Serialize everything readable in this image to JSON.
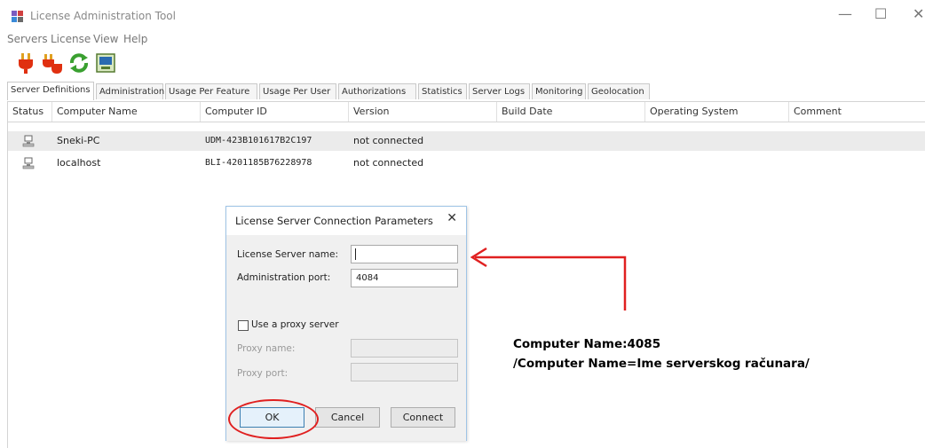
{
  "window": {
    "title": "License Administration Tool",
    "controls": {
      "minimize": "—",
      "maximize": "☐",
      "close": "✕"
    }
  },
  "menu": [
    "Servers",
    "License",
    "View",
    "Help"
  ],
  "toolbar": {
    "buttons": [
      {
        "icon": "connect-plug-icon"
      },
      {
        "icon": "disconnect-plug-icon"
      },
      {
        "icon": "refresh-icon"
      },
      {
        "icon": "server-properties-icon"
      }
    ]
  },
  "tabs": [
    {
      "label": "Server Definitions",
      "active": true
    },
    {
      "label": "Administration"
    },
    {
      "label": "Usage Per Feature"
    },
    {
      "label": "Usage Per User"
    },
    {
      "label": "Authorizations"
    },
    {
      "label": "Statistics"
    },
    {
      "label": "Server Logs"
    },
    {
      "label": "Monitoring"
    },
    {
      "label": "Geolocation"
    }
  ],
  "table": {
    "columns": [
      "Status",
      "Computer Name",
      "Computer ID",
      "Version",
      "Build Date",
      "Operating System",
      "Comment"
    ],
    "rows": [
      {
        "status_icon": "computer-icon",
        "computer_name": "Sneki-PC",
        "computer_id": "UDM-423B101617B2C197",
        "version": "not connected",
        "build_date": "",
        "os": "",
        "comment": ""
      },
      {
        "status_icon": "computer-icon",
        "computer_name": "localhost",
        "computer_id": "BLI-4201185B76228978",
        "version": "not connected",
        "build_date": "",
        "os": "",
        "comment": ""
      }
    ]
  },
  "dialog": {
    "title": "License Server Connection Parameters",
    "close": "✕",
    "server_name_label": "License Server name:",
    "server_name_value": "",
    "admin_port_label": "Administration port:",
    "admin_port_value": "4084",
    "proxy_checkbox_label": "Use a proxy server",
    "proxy_checked": false,
    "proxy_name_label": "Proxy name:",
    "proxy_port_label": "Proxy port:",
    "ok_label": "OK",
    "cancel_label": "Cancel",
    "connect_label": "Connect"
  },
  "annotation": {
    "line1": "Computer Name:4085",
    "line2": "/Computer Name=Ime serverskog računara/",
    "color": "#e02020"
  }
}
